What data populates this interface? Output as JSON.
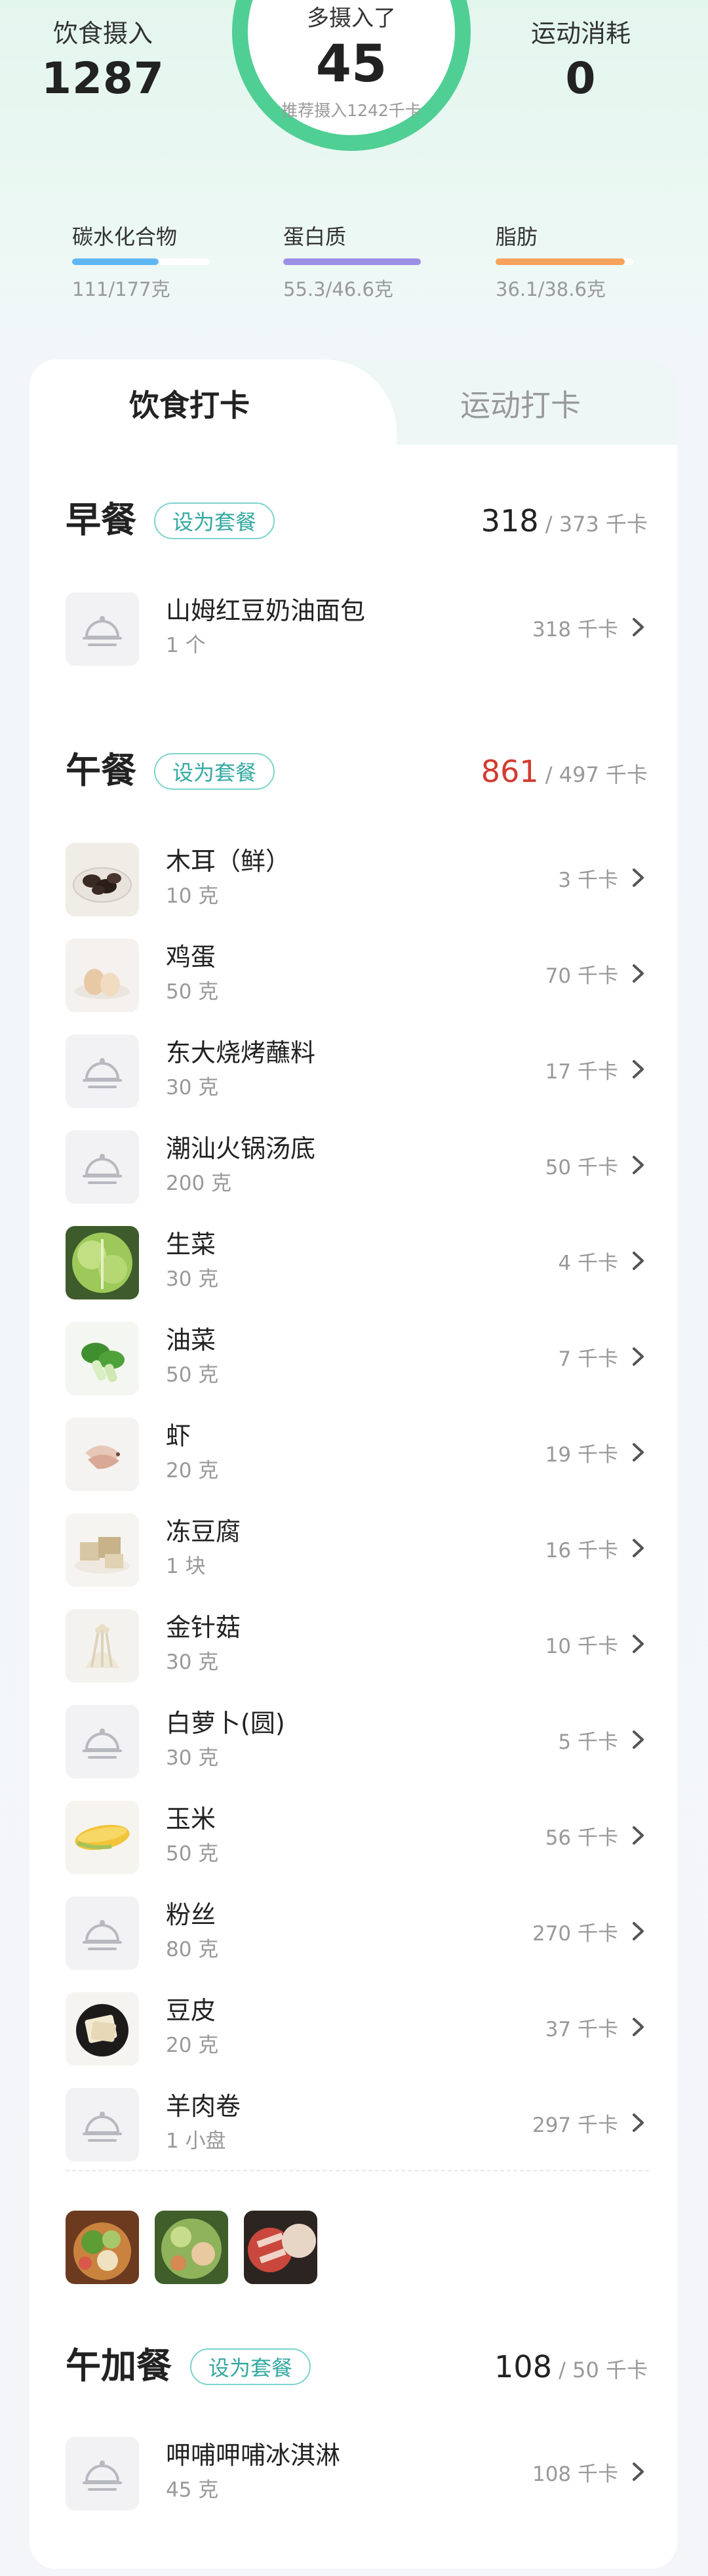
{
  "summary": {
    "intake_label": "饮食摄入",
    "intake_value": "1287",
    "ring_title": "多摄入了",
    "ring_value": "45",
    "ring_sub": "推荐摄入1242千卡",
    "ring_progress": 1.0,
    "exercise_label": "运动消耗",
    "exercise_value": "0"
  },
  "macros": [
    {
      "name": "碳水化合物",
      "value": "111/177克",
      "fraction": 0.63,
      "color": "#5fb7f2"
    },
    {
      "name": "蛋白质",
      "value": "55.3/46.6克",
      "fraction": 1.0,
      "color": "#9b8fe6"
    },
    {
      "name": "脂肪",
      "value": "36.1/38.6克",
      "fraction": 0.94,
      "color": "#f6a25c"
    }
  ],
  "tabs": {
    "active": "饮食打卡",
    "inactive": "运动打卡"
  },
  "set_label": "设为套餐",
  "kcal_unit": "千卡",
  "meals": {
    "breakfast": {
      "title": "早餐",
      "eaten": "318",
      "target": "/ 373 千卡",
      "items": [
        {
          "name": "山姆红豆奶油面包",
          "amount": "1 个",
          "kcal": "318 千卡",
          "icon": "plate-icon"
        }
      ]
    },
    "lunch": {
      "title": "午餐",
      "eaten": "861",
      "target": "/ 497 千卡",
      "items": [
        {
          "name": "木耳（鲜）",
          "amount": "10 克",
          "kcal": "3 千卡",
          "icon": "wood-ear-photo"
        },
        {
          "name": "鸡蛋",
          "amount": "50 克",
          "kcal": "70 千卡",
          "icon": "egg-photo"
        },
        {
          "name": "东大烧烤蘸料",
          "amount": "30 克",
          "kcal": "17 千卡",
          "icon": "plate-icon"
        },
        {
          "name": "潮汕火锅汤底",
          "amount": "200 克",
          "kcal": "50 千卡",
          "icon": "plate-icon"
        },
        {
          "name": "生菜",
          "amount": "30 克",
          "kcal": "4 千卡",
          "icon": "lettuce-photo"
        },
        {
          "name": "油菜",
          "amount": "50 克",
          "kcal": "7 千卡",
          "icon": "bok-choy-photo"
        },
        {
          "name": "虾",
          "amount": "20 克",
          "kcal": "19 千卡",
          "icon": "shrimp-photo"
        },
        {
          "name": "冻豆腐",
          "amount": "1 块",
          "kcal": "16 千卡",
          "icon": "tofu-photo"
        },
        {
          "name": "金针菇",
          "amount": "30 克",
          "kcal": "10 千卡",
          "icon": "enoki-photo"
        },
        {
          "name": "白萝卜(圆)",
          "amount": "30 克",
          "kcal": "5 千卡",
          "icon": "plate-icon"
        },
        {
          "name": "玉米",
          "amount": "50 克",
          "kcal": "56 千卡",
          "icon": "corn-photo"
        },
        {
          "name": "粉丝",
          "amount": "80 克",
          "kcal": "270 千卡",
          "icon": "plate-icon"
        },
        {
          "name": "豆皮",
          "amount": "20 克",
          "kcal": "37 千卡",
          "icon": "tofu-skin-photo"
        },
        {
          "name": "羊肉卷",
          "amount": "1 小盘",
          "kcal": "297 千卡",
          "icon": "plate-icon"
        }
      ]
    },
    "snack": {
      "title": "午加餐",
      "eaten": "108",
      "target": "/ 50 千卡",
      "items": [
        {
          "name": "呷哺呷哺冰淇淋",
          "amount": "45 克",
          "kcal": "108 千卡",
          "icon": "plate-icon"
        }
      ]
    }
  },
  "meal_photos": [
    "hotpot-photo-1",
    "hotpot-photo-2",
    "hotpot-photo-3"
  ],
  "colors": {
    "ring": "#4fcf94",
    "accent": "#34a9a1",
    "over": "#d23b2f"
  }
}
